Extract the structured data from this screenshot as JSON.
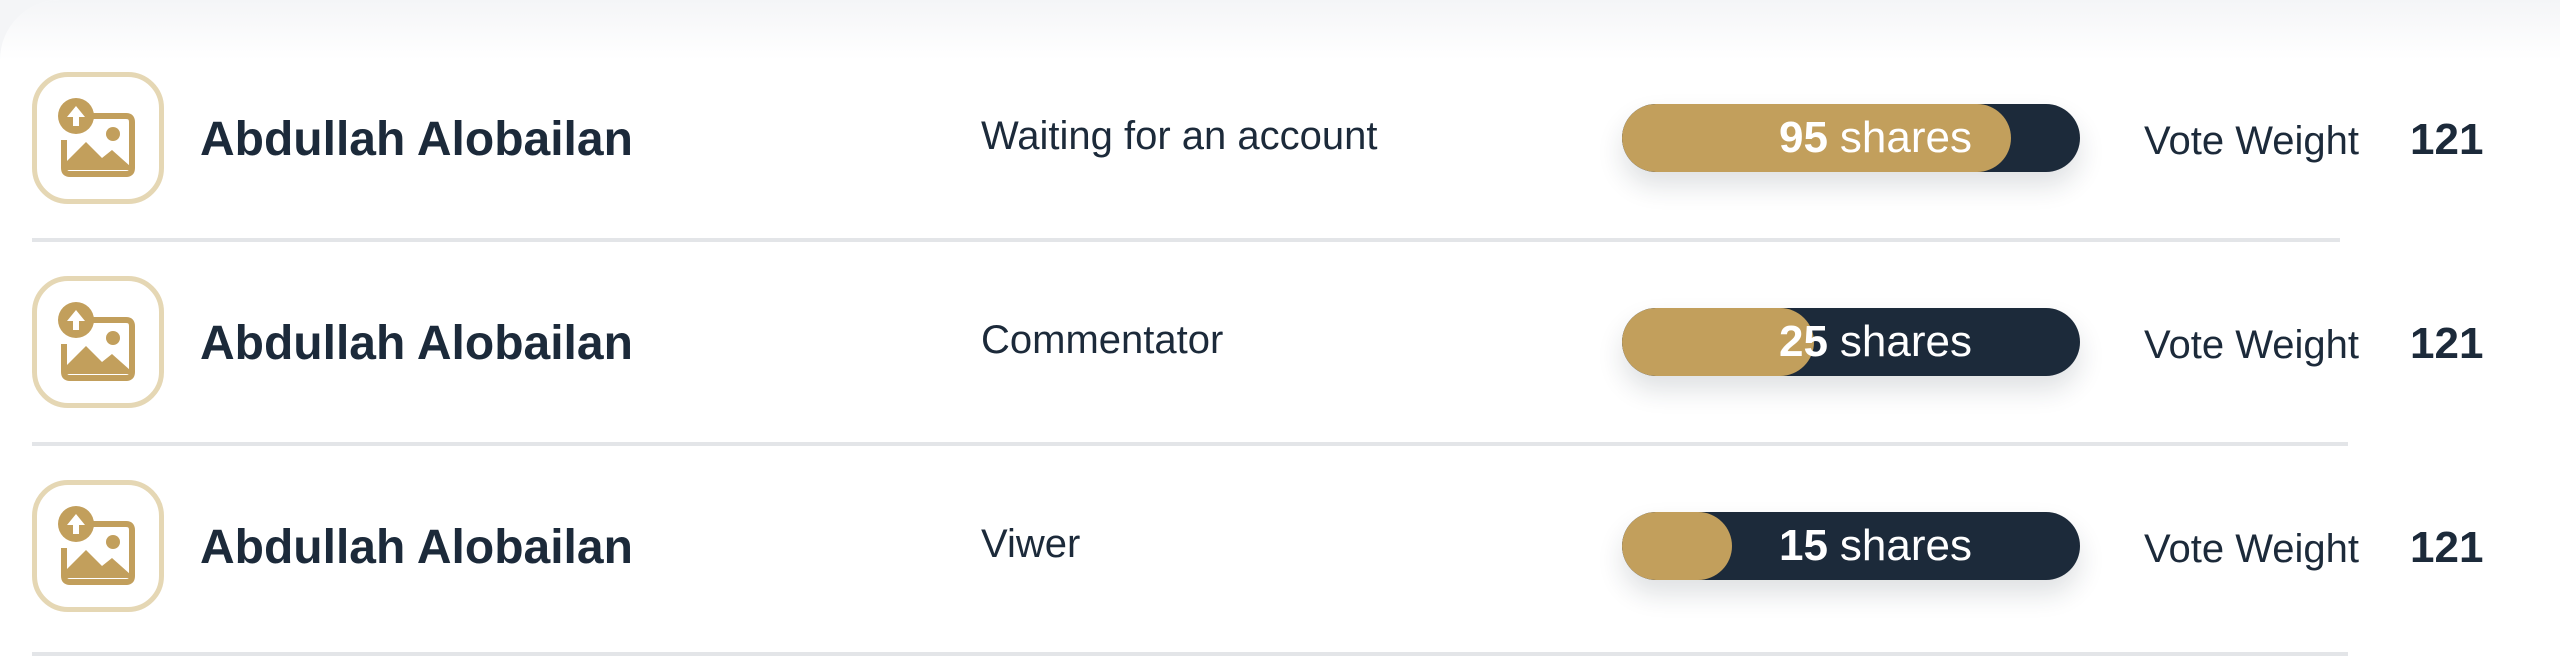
{
  "colors": {
    "accent": "#c29f5c",
    "dark": "#1c2a3a",
    "avatar_border": "#e5d7b4",
    "divider": "#e3e5e8"
  },
  "members": [
    {
      "avatar_icon": "image-upload-icon",
      "name": "Abdullah Alobailan",
      "role": "Waiting for an account",
      "shares": "95",
      "shares_unit": "shares",
      "shares_fill": 0.85,
      "vote_label": "Vote Weight",
      "vote_value": "121"
    },
    {
      "avatar_icon": "image-upload-icon",
      "name": "Abdullah Alobailan",
      "role": "Commentator",
      "shares": "25",
      "shares_unit": "shares",
      "shares_fill": 0.42,
      "vote_label": "Vote Weight",
      "vote_value": "121"
    },
    {
      "avatar_icon": "image-upload-icon",
      "name": "Abdullah Alobailan",
      "role": "Viwer",
      "shares": "15",
      "shares_unit": "shares",
      "shares_fill": 0.24,
      "vote_label": "Vote Weight",
      "vote_value": "121"
    }
  ]
}
